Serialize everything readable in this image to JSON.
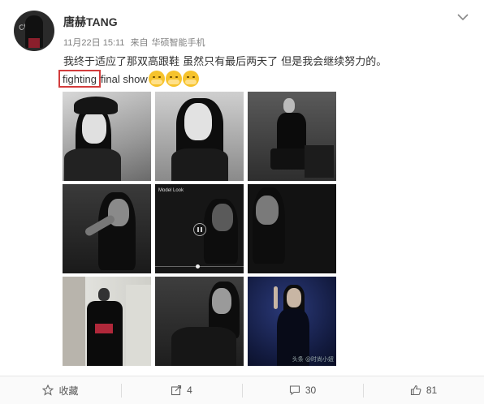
{
  "post": {
    "author": "唐赫TANG",
    "time": "11月22日 15:11",
    "source_prefix": "来自",
    "source": "华硕智能手机",
    "text_line1": "我终于适应了那双高跟鞋 虽然只有最后两天了 但是我会继续努力的。",
    "highlighted_word": "fighting",
    "text_after": "final show",
    "emoji_count": 3
  },
  "media": {
    "video_title": "Model Look",
    "watermark": "头条 @时尚小妞"
  },
  "actions": {
    "favorite_label": "收藏",
    "repost_count": "4",
    "comment_count": "30",
    "like_count": "81"
  },
  "colors": {
    "highlight_border": "#d23c3c",
    "username": "#333333",
    "meta": "#808080"
  }
}
